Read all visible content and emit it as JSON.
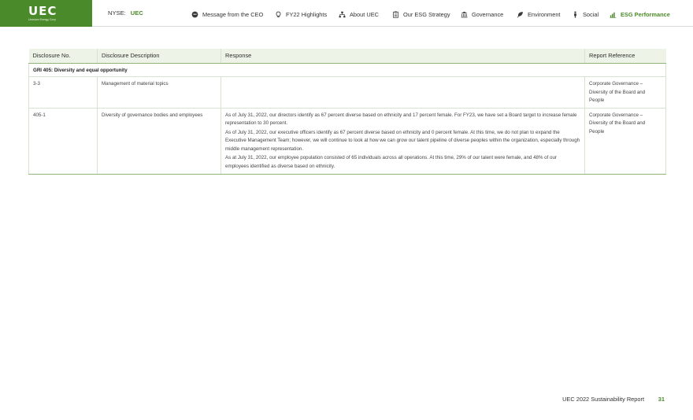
{
  "header": {
    "logo_text": "UEC",
    "logo_subtext": "Uranium Energy Corp",
    "ticker_label": "NYSE:",
    "ticker_symbol": "UEC",
    "nav": [
      {
        "label": "Message from the CEO",
        "icon": "message-icon"
      },
      {
        "label": "FY22 Highlights",
        "icon": "lightbulb-icon"
      },
      {
        "label": "About UEC",
        "icon": "org-chart-icon"
      },
      {
        "label": "Our ESG Strategy",
        "icon": "clipboard-icon"
      },
      {
        "label": "Governance",
        "icon": "bank-icon"
      },
      {
        "label": "Environment",
        "icon": "leaf-icon"
      },
      {
        "label": "Social",
        "icon": "person-icon"
      },
      {
        "label": "ESG Performance",
        "icon": "bar-chart-icon",
        "active": true
      }
    ]
  },
  "table": {
    "headers": [
      "Disclosure No.",
      "Disclosure Description",
      "Response",
      "Report Reference"
    ],
    "group_title": "GRI 405: Diversity and equal opportunity",
    "rows": [
      {
        "no": "3-3",
        "description": "Management of material topics",
        "responses": [],
        "reference": "Corporate Governance – Diversity of the Board and People"
      },
      {
        "no": "405-1",
        "description": "Diversity of governance bodies and employees",
        "responses": [
          "As of July 31, 2022, our directors identify as 67 percent diverse based on ethnicity and 17 percent female. For FY23, we have set a Board target to increase female representation to 30 percent.",
          "As of July 31, 2022, our executive officers identify as 67 percent diverse based on ethnicity and 0 percent female. At this time, we do not plan to expand the Executive Management Team; however, we will continue to look at how we can grow our talent pipeline of diverse peoples within the organization, especially through middle management representation.",
          "As at July 31, 2022, our employee population consisted of 65 individuals across all operations. At this time, 29% of our talent were female, and 48% of our employees identified as diverse based on ethnicity."
        ],
        "reference": "Corporate Governance – Diversity of the Board and People"
      }
    ]
  },
  "footer": {
    "report_title": "UEC 2022 Sustainability Report",
    "page_number": "31"
  },
  "colors": {
    "brand_green": "#4a8a2a",
    "header_fill": "#eef3e8",
    "rule_green": "#8fb57a"
  }
}
